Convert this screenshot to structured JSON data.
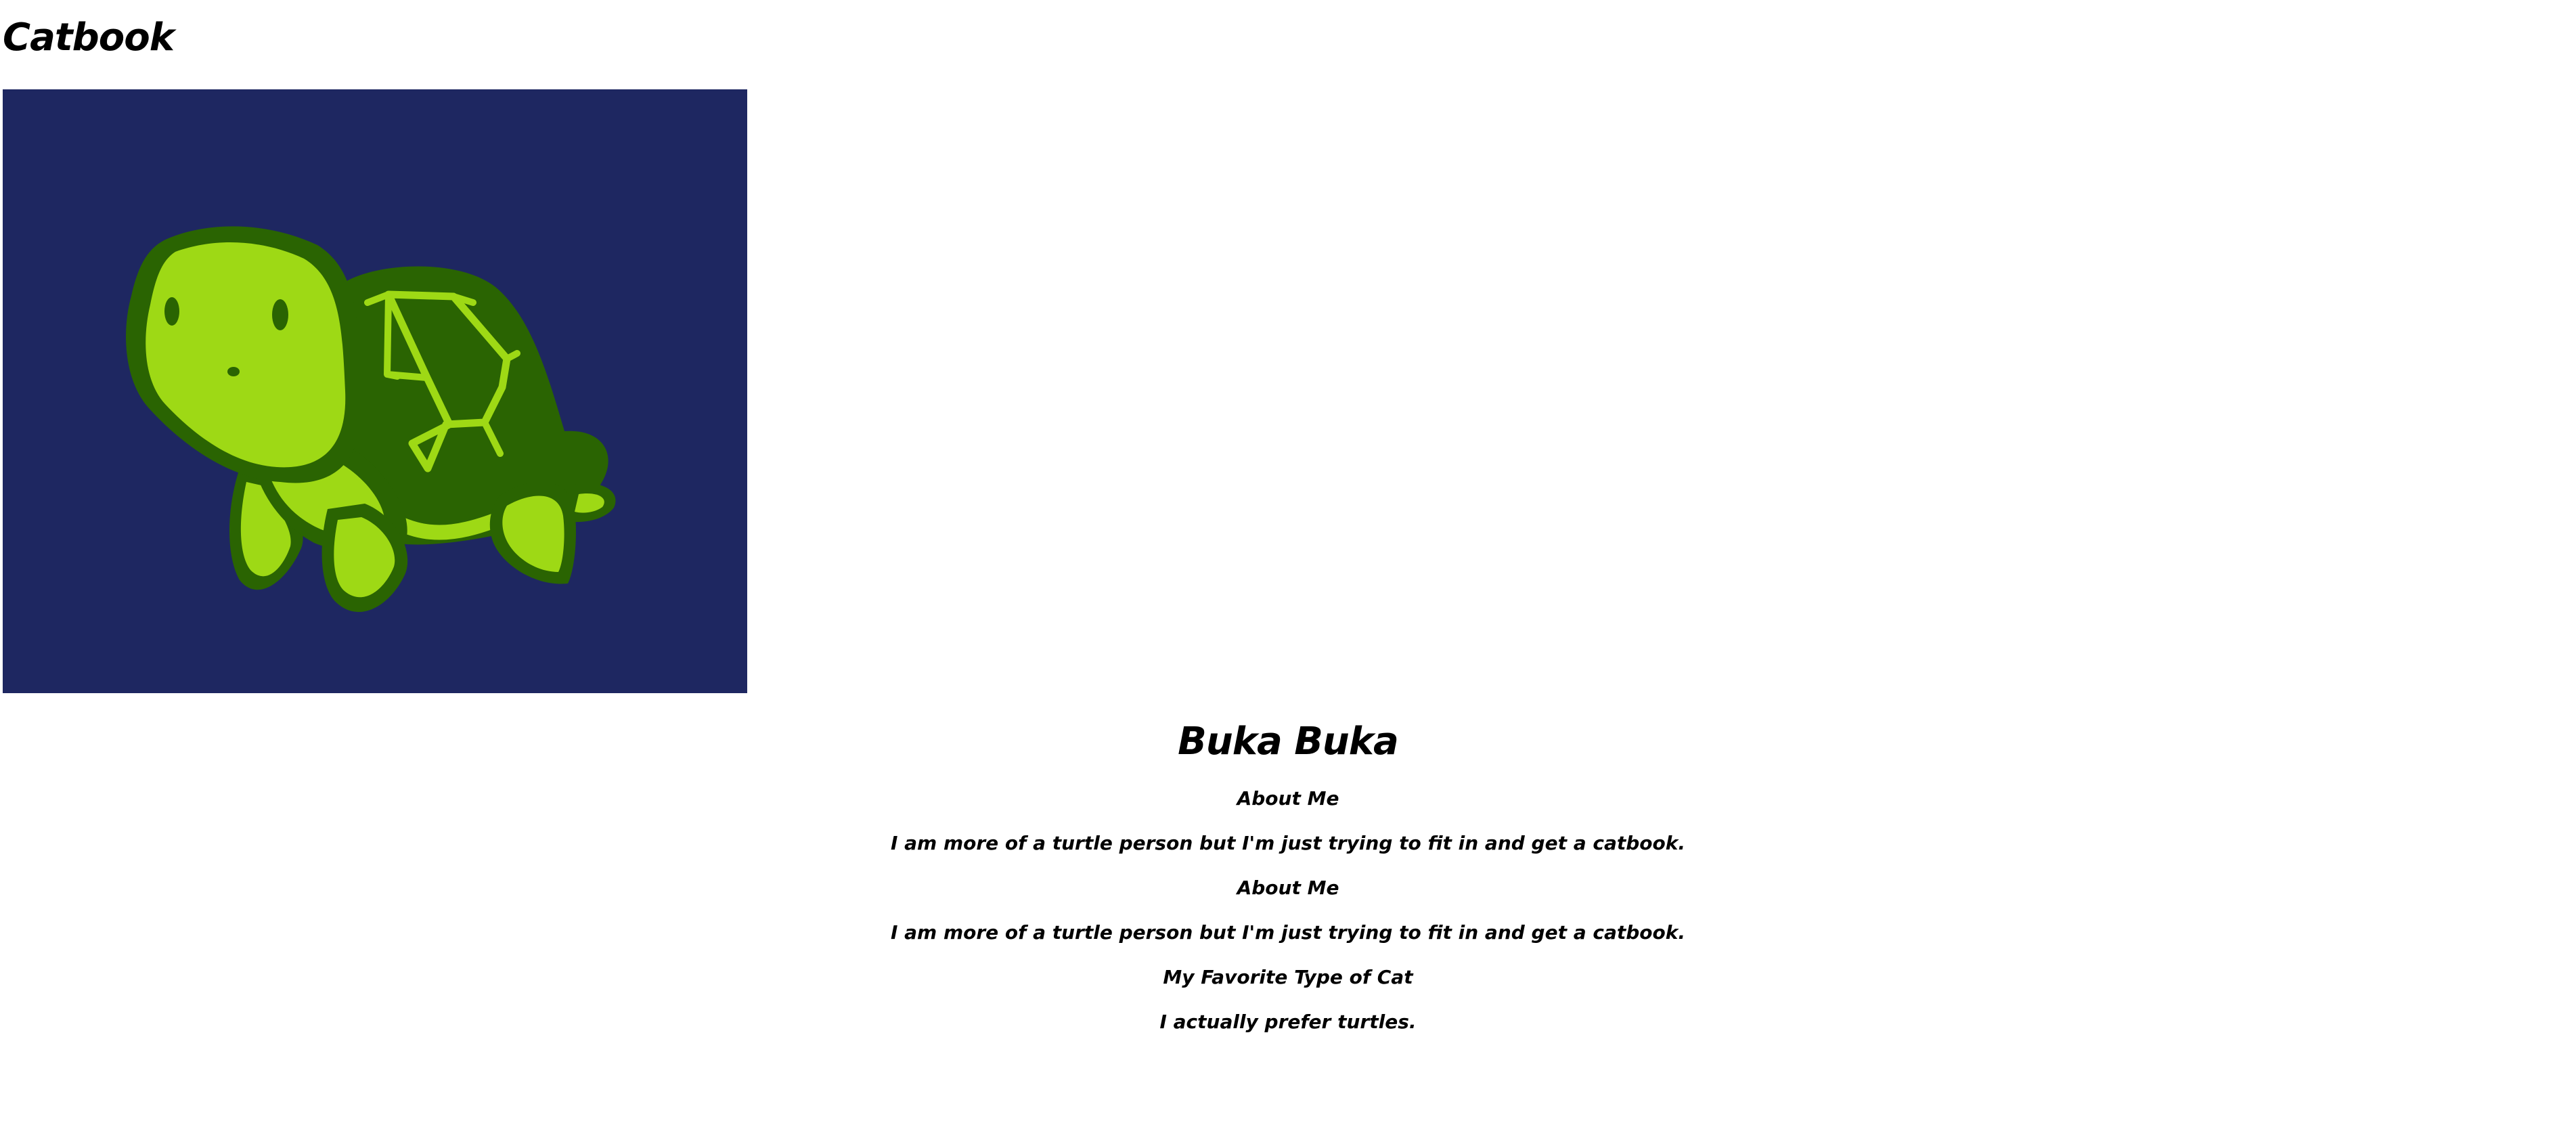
{
  "site": {
    "title": "Catbook"
  },
  "profile": {
    "name": "Buka Buka",
    "image_subject": "turtle-illustration",
    "colors": {
      "image_background": "#1e2761",
      "turtle_light_green": "#9ed915",
      "turtle_dark_green": "#2a6402"
    },
    "sections": [
      {
        "heading": "About Me",
        "text": "I am more of a turtle person but I'm just trying to fit in and get a catbook."
      },
      {
        "heading": "About Me",
        "text": "I am more of a turtle person but I'm just trying to fit in and get a catbook."
      },
      {
        "heading": "My Favorite Type of Cat",
        "text": "I actually prefer turtles."
      }
    ]
  }
}
